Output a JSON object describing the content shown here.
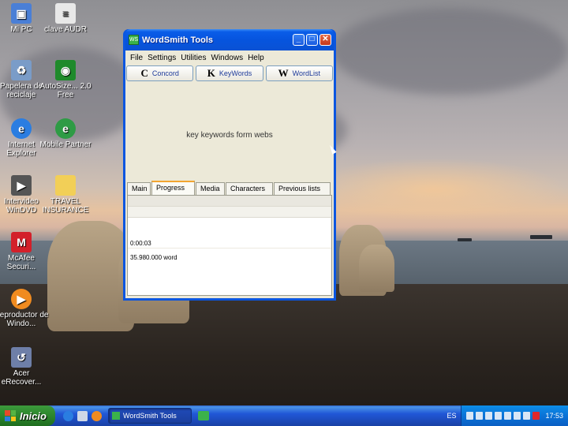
{
  "desktop": {
    "icons": [
      {
        "label": "Mi PC",
        "icon": "computer-icon",
        "color": "#4a7fd6"
      },
      {
        "label": "clave AUDR",
        "icon": "document-icon",
        "color": "#e8e8e8"
      },
      {
        "label": "Papelera de reciclaje",
        "icon": "recycle-bin-icon",
        "color": "#7a9cc8"
      },
      {
        "label": "AutoSize...\n2.0 Free",
        "icon": "autosize-icon",
        "color": "#1f8a2b"
      },
      {
        "label": "Internet Explorer",
        "icon": "internet-explorer-icon",
        "color": "#2a7de1"
      },
      {
        "label": "Mobile Partner",
        "icon": "mobile-partner-icon",
        "color": "#2e9b45"
      },
      {
        "label": "Intervideo WinDVD",
        "icon": "windvd-icon",
        "color": "#555555"
      },
      {
        "label": "TRAVEL INSURANCE",
        "icon": "folder-icon",
        "color": "#f2cf57"
      },
      {
        "label": "McAfee Securi...",
        "icon": "mcafee-icon",
        "color": "#d3202a"
      },
      {
        "label": "Reproductor de Windo...",
        "icon": "media-player-icon",
        "color": "#f08b20"
      },
      {
        "label": "Acer eRecover...",
        "icon": "erecovery-icon",
        "color": "#6e7fa8"
      }
    ]
  },
  "window": {
    "title": "WordSmith Tools",
    "title_icon": "WS",
    "controls": {
      "minimize": "_",
      "maximize": "□",
      "close": "✕"
    },
    "menu": [
      "File",
      "Settings",
      "Utilities",
      "Windows",
      "Help"
    ],
    "toolbar": [
      {
        "letter": "C",
        "label": "Concord"
      },
      {
        "letter": "K",
        "label": "KeyWords"
      },
      {
        "letter": "W",
        "label": "WordList"
      }
    ],
    "status_text": "key keywords form webs",
    "tabs": [
      "Main",
      "Progress",
      "Media",
      "Characters",
      "Previous lists"
    ],
    "active_tab": "Progress",
    "progress": {
      "time": "0:00:03",
      "words": "35.980.000 word"
    }
  },
  "taskbar": {
    "start_label": "Inicio",
    "task_button": "WordSmith Tools",
    "language": "ES",
    "clock": "17:53",
    "colors": {
      "start": "#2f8a2f",
      "bar": "#2157d7",
      "tray": "#0b72d6"
    }
  }
}
